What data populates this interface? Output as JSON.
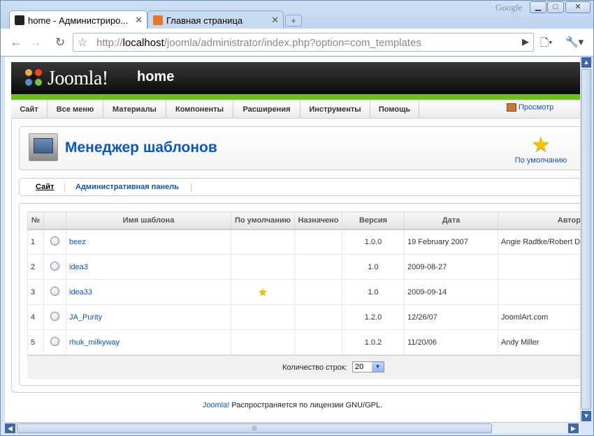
{
  "browser": {
    "google_label": "Google",
    "tabs": [
      {
        "title": "home - Администриро...",
        "active": true
      },
      {
        "title": "Главная страница",
        "active": false
      }
    ],
    "url_prefix": "http://",
    "url_host": "localhost",
    "url_path": "/joomla/administrator/index.php?option=com_templates"
  },
  "joomla": {
    "logo_text": "Joomla!",
    "site_name": "home",
    "menu": [
      "Сайт",
      "Все меню",
      "Материалы",
      "Компоненты",
      "Расширения",
      "Инструменты",
      "Помощь"
    ],
    "preview_label": "Просмотр",
    "page_title": "Менеджер шаблонов",
    "default_button_label": "По умолчанию",
    "submenu": [
      {
        "label": "Сайт",
        "active": true
      },
      {
        "label": "Административная панель",
        "active": false
      }
    ],
    "table": {
      "headers": [
        "№",
        "",
        "Имя шаблона",
        "По умолчанию",
        "Назначено",
        "Версия",
        "Дата",
        "Автор"
      ],
      "rows": [
        {
          "num": "1",
          "name": "beez",
          "default": false,
          "version": "1.0.0",
          "date": "19 February 2007",
          "author": "Angie Radtke/Robert Deutz"
        },
        {
          "num": "2",
          "name": "idea3",
          "default": false,
          "version": "1.0",
          "date": "2009-08-27",
          "author": ""
        },
        {
          "num": "3",
          "name": "idea33",
          "default": true,
          "version": "1.0",
          "date": "2009-09-14",
          "author": ""
        },
        {
          "num": "4",
          "name": "JA_Purity",
          "default": false,
          "version": "1.2.0",
          "date": "12/26/07",
          "author": "JoomlArt.com"
        },
        {
          "num": "5",
          "name": "rhuk_milkyway",
          "default": false,
          "version": "1.0.2",
          "date": "11/20/06",
          "author": "Andy Miller"
        }
      ],
      "rows_label": "Количество строк:",
      "rows_value": "20"
    },
    "footer_link": "Joomla!",
    "footer_text": " Распространяется по лицензии GNU/GPL."
  }
}
